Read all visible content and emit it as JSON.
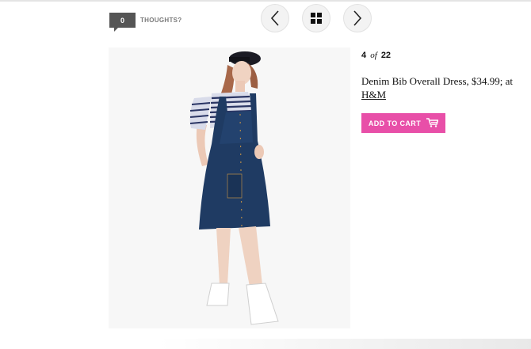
{
  "header": {
    "comments_count": "0",
    "comments_label": "THOUGHTS?"
  },
  "nav": {
    "prev_icon": "chevron-left-icon",
    "grid_icon": "grid-icon",
    "next_icon": "chevron-right-icon"
  },
  "slide": {
    "current": "4",
    "of_word": "of",
    "total": "22",
    "caption_text": "Denim Bib Overall Dress, $34.99; at",
    "caption_link": "H&M",
    "image_alt": "model wearing denim bib overall dress"
  },
  "cart": {
    "label": "ADD TO CART",
    "icon": "shopping-cart-icon",
    "color": "#e84fa8"
  }
}
